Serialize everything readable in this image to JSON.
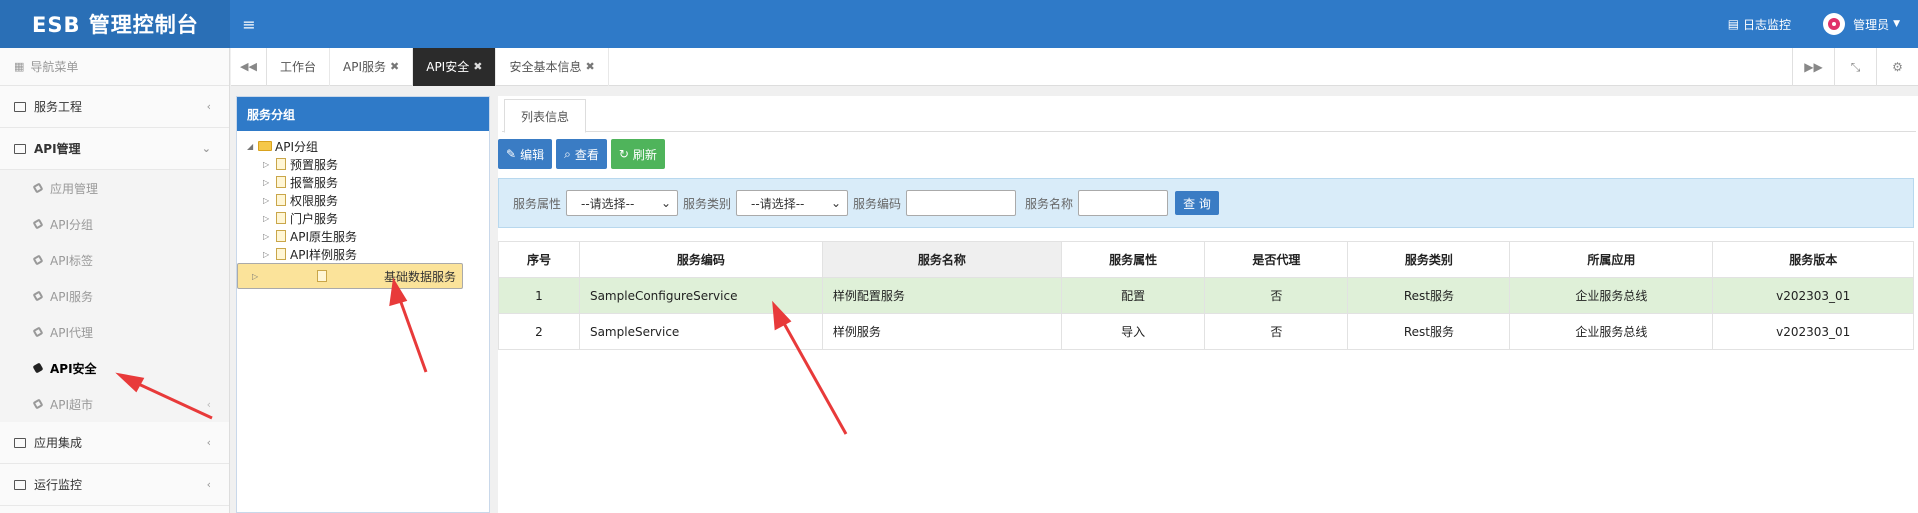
{
  "app": {
    "title": "ESB 管理控制台",
    "menu_icon": "≡"
  },
  "header": {
    "log_link": "日志监控",
    "user": "管理员"
  },
  "sidebar": {
    "heading": "导航菜单",
    "groups": [
      {
        "label": "服务工程"
      },
      {
        "label": "API管理",
        "open": true
      },
      {
        "label": "应用集成"
      },
      {
        "label": "运行监控"
      }
    ],
    "api_items": [
      {
        "label": "应用管理"
      },
      {
        "label": "API分组"
      },
      {
        "label": "API标签"
      },
      {
        "label": "API服务"
      },
      {
        "label": "API代理"
      },
      {
        "label": "API安全",
        "active": true
      },
      {
        "label": "API超市"
      }
    ]
  },
  "tabs": [
    {
      "label": "工作台"
    },
    {
      "label": "API服务",
      "closable": true
    },
    {
      "label": "API安全",
      "closable": true,
      "active": true
    },
    {
      "label": "安全基本信息",
      "closable": true
    }
  ],
  "group_panel": {
    "title": "服务分组",
    "root": "API分组",
    "children": [
      "预置服务",
      "报警服务",
      "权限服务",
      "门户服务",
      "API原生服务",
      "API样例服务",
      "基础数据服务"
    ],
    "selected": "基础数据服务"
  },
  "main": {
    "tab_label": "列表信息",
    "buttons": {
      "edit": "编辑",
      "view": "查看",
      "refresh": "刷新"
    },
    "search": {
      "attr_label": "服务属性",
      "attr_value": "--请选择--",
      "category_label": "服务类别",
      "category_value": "--请选择--",
      "code_label": "服务编码",
      "name_label": "服务名称",
      "query": "查 询"
    },
    "columns": [
      "序号",
      "服务编码",
      "服务名称",
      "服务属性",
      "是否代理",
      "服务类别",
      "所属应用",
      "服务版本"
    ],
    "rows": [
      {
        "no": "1",
        "code": "SampleConfigureService",
        "name": "样例配置服务",
        "attr": "配置",
        "proxy": "否",
        "category": "Rest服务",
        "app": "企业服务总线",
        "version": "v202303_01"
      },
      {
        "no": "2",
        "code": "SampleService",
        "name": "样例服务",
        "attr": "导入",
        "proxy": "否",
        "category": "Rest服务",
        "app": "企业服务总线",
        "version": "v202303_01"
      }
    ]
  },
  "colors": {
    "header": "#2f7ac8",
    "logo": "#2a6fb6",
    "highlight_row": "#dff0d8",
    "selected_tree": "#fbe39a",
    "arrow": "#e83a3a"
  }
}
